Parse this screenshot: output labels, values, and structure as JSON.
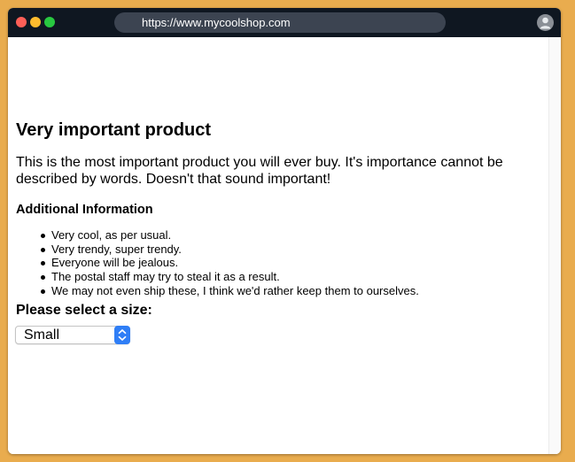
{
  "browser": {
    "url": "https://www.mycoolshop.com",
    "traffic_lights": {
      "close": "#fe5f57",
      "minimize": "#febc2e",
      "maximize": "#28c840"
    },
    "profile_icon": "user-icon"
  },
  "product": {
    "title": "Very important product",
    "description": "This is the most important product you will ever buy. It's importance cannot be described by words. Doesn't that sound important!",
    "additional_heading": "Additional Information",
    "features": [
      "Very cool, as per usual.",
      "Very trendy, super trendy.",
      "Everyone will be jealous.",
      "The postal staff may try to steal it as a result.",
      "We may not even ship these, I think we'd rather keep them to ourselves."
    ]
  },
  "size_selector": {
    "label": "Please select a size:",
    "selected": "Small",
    "icon": "chevron-updown-icon"
  },
  "colors": {
    "background": "#e9ac4e",
    "titlebar": "#0f1721",
    "urlbar": "#3c4451",
    "select_accent": "#2f7ef6"
  }
}
